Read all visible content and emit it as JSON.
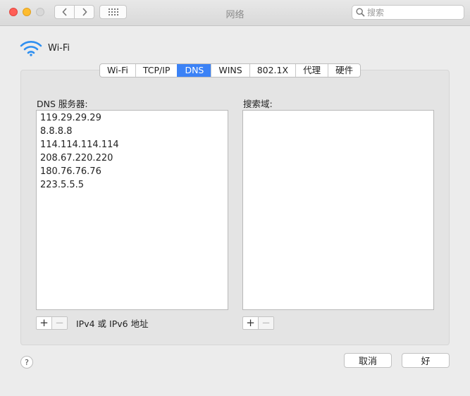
{
  "window": {
    "title": "网络",
    "search_placeholder": "搜索",
    "colors": {
      "accent": "#3b82f6",
      "close": "#ff5f57",
      "minimize": "#febc2e"
    }
  },
  "header": {
    "interface_name": "Wi-Fi",
    "icon": "wifi-icon"
  },
  "tabs": [
    {
      "label": "Wi-Fi",
      "active": false
    },
    {
      "label": "TCP/IP",
      "active": false
    },
    {
      "label": "DNS",
      "active": true
    },
    {
      "label": "WINS",
      "active": false
    },
    {
      "label": "802.1X",
      "active": false
    },
    {
      "label": "代理",
      "active": false
    },
    {
      "label": "硬件",
      "active": false
    }
  ],
  "dns": {
    "label": "DNS 服务器:",
    "servers": [
      "119.29.29.29",
      "8.8.8.8",
      "114.114.114.114",
      "208.67.220.220",
      "180.76.76.76",
      "223.5.5.5"
    ],
    "add": "+",
    "remove": "−",
    "hint": "IPv4 或 IPv6 地址"
  },
  "search_domains": {
    "label": "搜索域:",
    "items": [],
    "add": "+",
    "remove": "−"
  },
  "footer": {
    "help": "?",
    "cancel": "取消",
    "ok": "好"
  }
}
